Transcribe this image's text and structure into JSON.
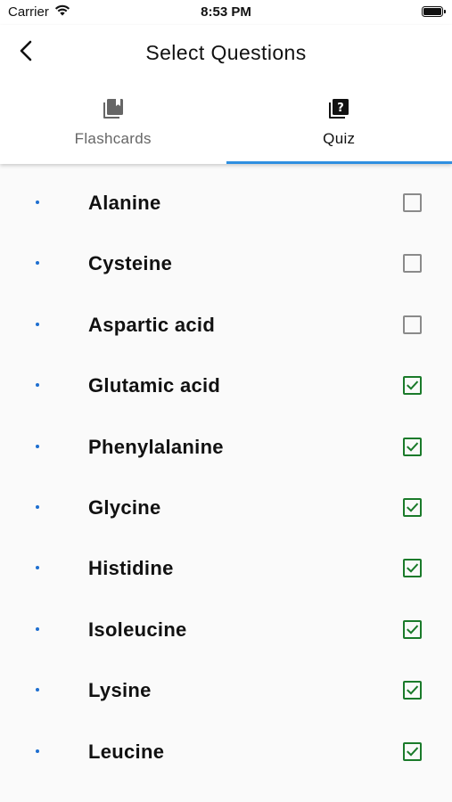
{
  "status_bar": {
    "carrier": "Carrier",
    "time": "8:53 PM"
  },
  "header": {
    "title": "Select Questions",
    "back_icon": "chevron-left-icon"
  },
  "tabs": [
    {
      "label": "Flashcards",
      "icon": "cards-icon",
      "active": false
    },
    {
      "label": "Quiz",
      "icon": "quiz-icon",
      "active": true
    }
  ],
  "colors": {
    "accent": "#2f8fe0",
    "check_green": "#1a7a2a",
    "bullet_blue": "#1e6fd0",
    "unchecked_gray": "#8a8a8a"
  },
  "items": [
    {
      "label": "Alanine",
      "checked": false
    },
    {
      "label": "Cysteine",
      "checked": false
    },
    {
      "label": "Aspartic acid",
      "checked": false
    },
    {
      "label": "Glutamic acid",
      "checked": true
    },
    {
      "label": "Phenylalanine",
      "checked": true
    },
    {
      "label": "Glycine",
      "checked": true
    },
    {
      "label": "Histidine",
      "checked": true
    },
    {
      "label": "Isoleucine",
      "checked": true
    },
    {
      "label": "Lysine",
      "checked": true
    },
    {
      "label": "Leucine",
      "checked": true
    }
  ]
}
